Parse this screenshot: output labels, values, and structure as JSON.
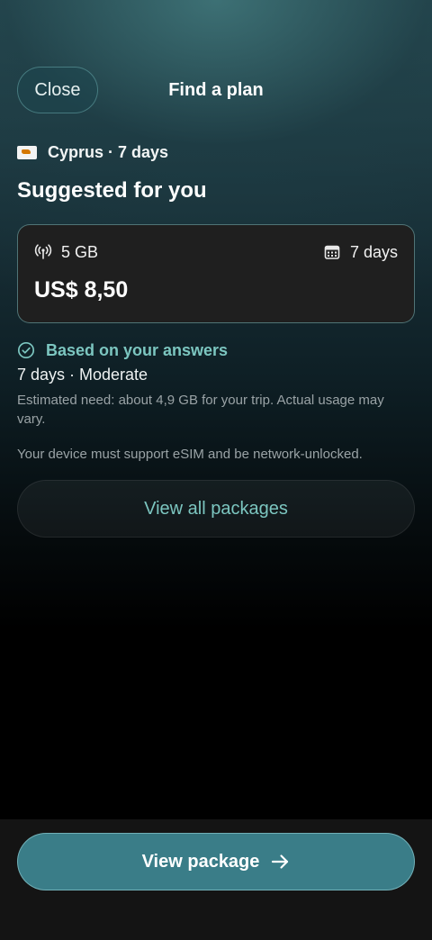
{
  "header": {
    "close_label": "Close",
    "title": "Find a plan"
  },
  "location": {
    "flag_icon": "cyprus-flag-icon",
    "label": "Cyprus · 7 days"
  },
  "suggested": {
    "title": "Suggested for you",
    "plan": {
      "data_icon": "signal-antenna-icon",
      "data_amount": "5 GB",
      "days_icon": "calendar-icon",
      "duration": "7 days",
      "price": "US$ 8,50"
    }
  },
  "recommendation": {
    "icon": "check-circle-icon",
    "heading": "Based on your answers",
    "profile": "7 days · Moderate",
    "estimate": "Estimated need: about 4,9 GB for your trip. Actual usage may vary.",
    "device_note": "Your device must support eSIM and be network-unlocked."
  },
  "actions": {
    "view_all_label": "View all packages",
    "view_package_label": "View package",
    "view_package_icon": "arrow-right-icon"
  },
  "colors": {
    "accent": "#7cc6c0",
    "primary_button": "#3a7d88",
    "card_background": "#1f1f1f"
  }
}
